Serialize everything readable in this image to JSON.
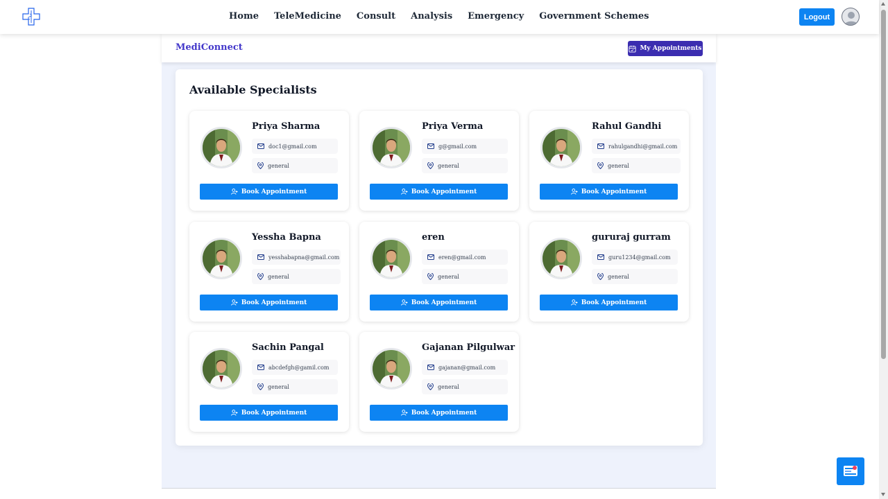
{
  "nav": {
    "links": [
      "Home",
      "TeleMedicine",
      "Consult",
      "Analysis",
      "Emergency",
      "Government Schemes"
    ],
    "logout_label": "Logout"
  },
  "subheader": {
    "brand": "MediConnect",
    "appointments_label": "My Appointments"
  },
  "section_title": "Available Specialists",
  "book_label": "Book Appointment",
  "doctors": [
    {
      "name": "Priya Sharma",
      "email": "doc1@gmail.com",
      "specialty": "general"
    },
    {
      "name": "Priya Verma",
      "email": "g@gmail.com",
      "specialty": "general"
    },
    {
      "name": "Rahul Gandhi",
      "email": "rahulgandhi@gmail.com",
      "specialty": "general"
    },
    {
      "name": "Yessha Bapna",
      "email": "yesshabapna@gmail.com",
      "specialty": "general"
    },
    {
      "name": "eren",
      "email": "eren@gmail.com",
      "specialty": "general"
    },
    {
      "name": "gururaj gurram",
      "email": "guru1234@gmail.com",
      "specialty": "general"
    },
    {
      "name": "Sachin Pangal",
      "email": "abcdefgh@gamil.com",
      "specialty": "general"
    },
    {
      "name": "Gajanan Pilgulwar",
      "email": "gajanan@gmail.com",
      "specialty": "general"
    }
  ],
  "colors": {
    "primary_blue": "#0d84f2",
    "brand_indigo": "#4338ca",
    "appointments_bg": "#3b2db0",
    "page_bg": "#eef2fc"
  },
  "icons": {
    "logo": "medical-cross-icon",
    "avatar": "user-avatar-icon",
    "calendar": "calendar-icon",
    "email": "mail-icon",
    "location": "location-pin-icon",
    "book": "user-plus-icon",
    "chat": "chat-bot-icon"
  }
}
